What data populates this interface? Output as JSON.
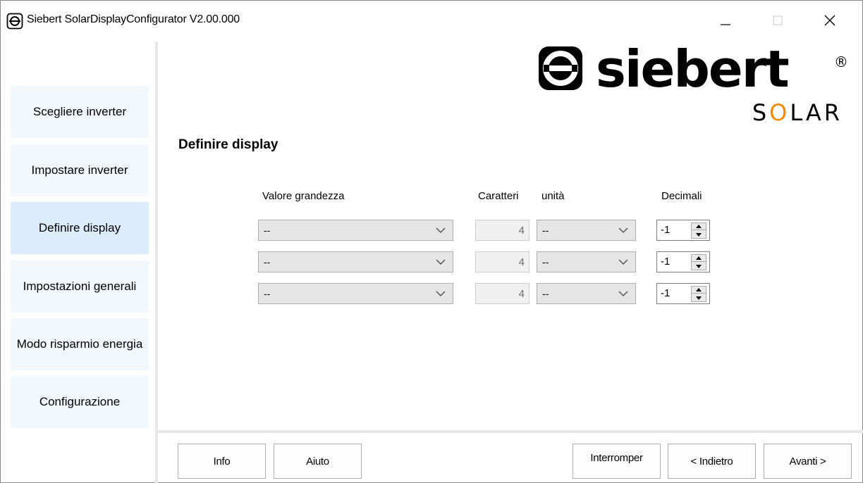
{
  "window": {
    "title": "Siebert SolarDisplayConfigurator V2.00.000"
  },
  "logo": {
    "brand": "siebert",
    "sub": "SOLAR",
    "mark": "®",
    "accent": "#f08a00"
  },
  "sidebar": {
    "items": [
      {
        "label": "Scegliere inverter"
      },
      {
        "label": "Impostare inverter"
      },
      {
        "label": "Definire display"
      },
      {
        "label": "Impostazioni generali"
      },
      {
        "label": "Modo risparmio energia"
      },
      {
        "label": "Configurazione"
      }
    ],
    "active": "Definire display"
  },
  "main": {
    "title": "Definire display",
    "headers": {
      "value": "Valore grandezza",
      "chars": "Caratteri",
      "unit": "unità",
      "decimals": "Decimali"
    },
    "rows": [
      {
        "value": "--",
        "chars": "4",
        "unit": "--",
        "decimals": "-1"
      },
      {
        "value": "--",
        "chars": "4",
        "unit": "--",
        "decimals": "-1"
      },
      {
        "value": "--",
        "chars": "4",
        "unit": "--",
        "decimals": "-1"
      }
    ]
  },
  "buttons": {
    "info": "Info",
    "help": "Aiuto",
    "cancel": "Interromper",
    "back": "< Indietro",
    "next": "Avanti >"
  }
}
